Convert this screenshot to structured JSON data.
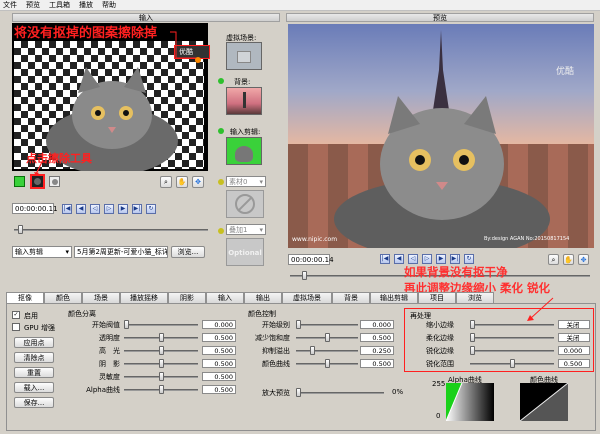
{
  "menu": [
    "文件",
    "预览",
    "工具箱",
    "播放",
    "帮助"
  ],
  "input_panel": {
    "title": "输入",
    "timecode": "00:00:00.11",
    "source_select": "输入剪辑",
    "file_name": "5月第2周更新-可爱小猫_标详",
    "browse_label": "浏览...",
    "watermark": "优酷"
  },
  "side": {
    "virtual_scene": "虚拟场景:",
    "background": "背景:",
    "input_clip": "输入剪辑:",
    "material": "素材0",
    "overlay": "叠加1",
    "optional": "Optional"
  },
  "preview_panel": {
    "title": "预览",
    "timecode": "00:00:00.14",
    "watermark": "优酷",
    "site": "www.nipic.com",
    "credit": "By:design AGAN No:20150817154"
  },
  "annotations": {
    "top": "将没有抠掉的图案擦除掉",
    "eraser": "点击擦除工具",
    "right_line1": "如果背景没有抠干净",
    "right_line2": "再此调整边缘缩小 柔化 锐化"
  },
  "tabs": [
    "抠像",
    "颜色",
    "场景",
    "播放摇移",
    "阴影",
    "输入",
    "输出",
    "虚拟场景",
    "背景",
    "输出剪辑",
    "项目",
    "浏览"
  ],
  "left_col": {
    "enable": "启用",
    "gpu": "GPU 增强",
    "apply_point": "应用点",
    "clear_point": "清除点",
    "reset": "重置",
    "load": "载入...",
    "save": "保存..."
  },
  "color_sep": {
    "title": "颜色分离",
    "rows": [
      {
        "label": "开始阀值",
        "value": "0.000",
        "pos": 0.0
      },
      {
        "label": "透明度",
        "value": "0.500",
        "pos": 0.5
      },
      {
        "label": "高　光",
        "value": "0.500",
        "pos": 0.5
      },
      {
        "label": "阴　影",
        "value": "0.500",
        "pos": 0.5
      },
      {
        "label": "灵敏度",
        "value": "0.500",
        "pos": 0.5
      },
      {
        "label": "Alpha曲线",
        "value": "0.500",
        "pos": 0.5
      }
    ]
  },
  "color_ctrl": {
    "title": "颜色控制",
    "rows": [
      {
        "label": "开始级别",
        "value": "0.000",
        "pos": 0.0
      },
      {
        "label": "减少饱和度",
        "value": "0.500",
        "pos": 0.5
      },
      {
        "label": "抑制溢出",
        "value": "0.250",
        "pos": 0.25
      },
      {
        "label": "颜色曲线",
        "value": "0.500",
        "pos": 0.5
      }
    ],
    "zoom_label": "放大预览",
    "zoom_value": "0%"
  },
  "reprocess": {
    "title": "再处理",
    "rows": [
      {
        "label": "缩小边缘",
        "value": "关闭",
        "pos": 0.0
      },
      {
        "label": "柔化边缘",
        "value": "关闭",
        "pos": 0.0
      },
      {
        "label": "锐化边缘",
        "value": "0.000",
        "pos": 0.0
      },
      {
        "label": "锐化范围",
        "value": "0.500",
        "pos": 0.5
      }
    ]
  },
  "curves": {
    "alpha_title": "Alpha曲线",
    "alpha_top": "255",
    "alpha_bottom": "0",
    "color_title": "颜色曲线"
  }
}
